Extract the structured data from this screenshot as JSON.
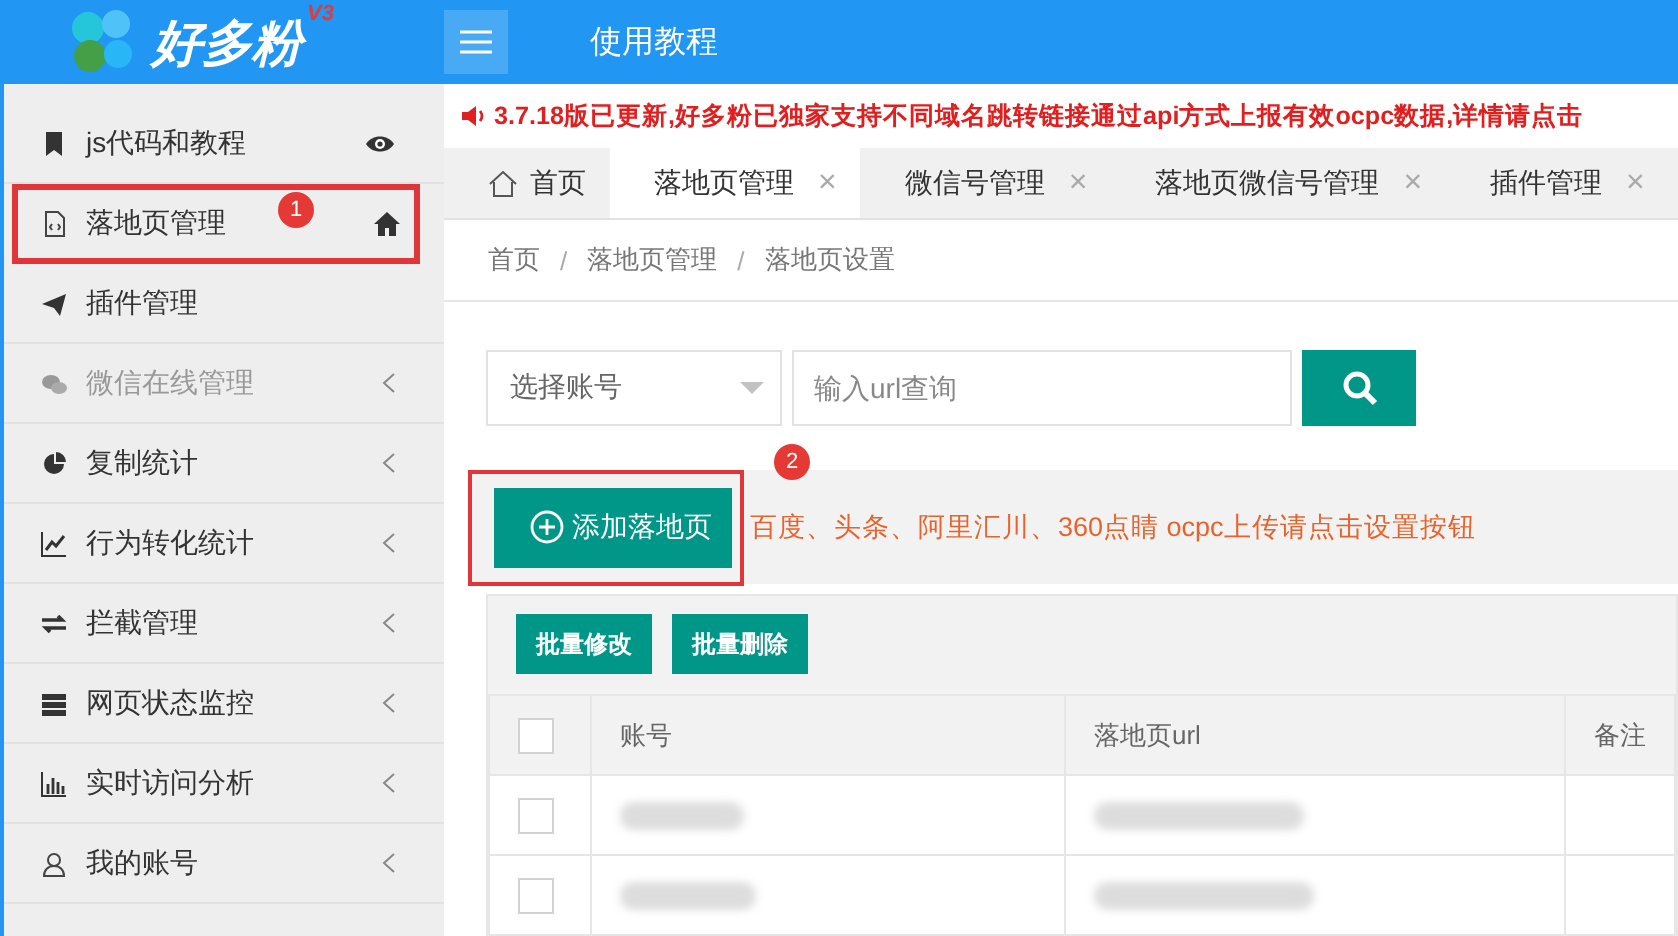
{
  "header": {
    "logo": "好多粉",
    "logo_version": "V3",
    "link": "使用教程"
  },
  "sidebar": {
    "items": [
      {
        "label": "js代码和教程",
        "disabled": false,
        "highlighted": false
      },
      {
        "label": "落地页管理",
        "disabled": false,
        "highlighted": true,
        "badge": "1"
      },
      {
        "label": "插件管理",
        "disabled": false,
        "highlighted": false
      },
      {
        "label": "微信在线管理",
        "disabled": true,
        "highlighted": false
      },
      {
        "label": "复制统计",
        "disabled": false,
        "highlighted": false
      },
      {
        "label": "行为转化统计",
        "disabled": false,
        "highlighted": false
      },
      {
        "label": "拦截管理",
        "disabled": false,
        "highlighted": false
      },
      {
        "label": "网页状态监控",
        "disabled": false,
        "highlighted": false
      },
      {
        "label": "实时访问分析",
        "disabled": false,
        "highlighted": false
      },
      {
        "label": "我的账号",
        "disabled": false,
        "highlighted": false
      }
    ]
  },
  "notice": "3.7.18版已更新,好多粉已独家支持不同域名跳转链接通过api方式上报有效ocpc数据,详情请点击",
  "tabs": [
    {
      "label": "首页",
      "kind": "home",
      "selected": false
    },
    {
      "label": "落地页管理",
      "kind": "closable",
      "close": "×",
      "selected": true
    },
    {
      "label": "微信号管理",
      "kind": "closable",
      "close": "×",
      "selected": false
    },
    {
      "label": "落地页微信号管理",
      "kind": "closable",
      "close": "×",
      "selected": false
    },
    {
      "label": "插件管理",
      "kind": "closable",
      "close": "×",
      "selected": false
    }
  ],
  "breadcrumb": [
    "首页",
    "落地页管理",
    "落地页设置"
  ],
  "breadcrumb_separator": "/",
  "search": {
    "select_placeholder": "选择账号",
    "placeholder": "输入url查询"
  },
  "add_button": {
    "label": "添加落地页",
    "highlighted": true,
    "badge": "2"
  },
  "tip": "百度、头条、阿里汇川、360点睛 ocpc上传请点击设置按钮",
  "batch_buttons": [
    "批量修改",
    "批量删除"
  ],
  "table": {
    "columns": [
      "账号",
      "落地页url",
      "备注"
    ],
    "select_all_checked": false,
    "rows": [
      {
        "checked": false
      },
      {
        "checked": false
      }
    ]
  }
}
